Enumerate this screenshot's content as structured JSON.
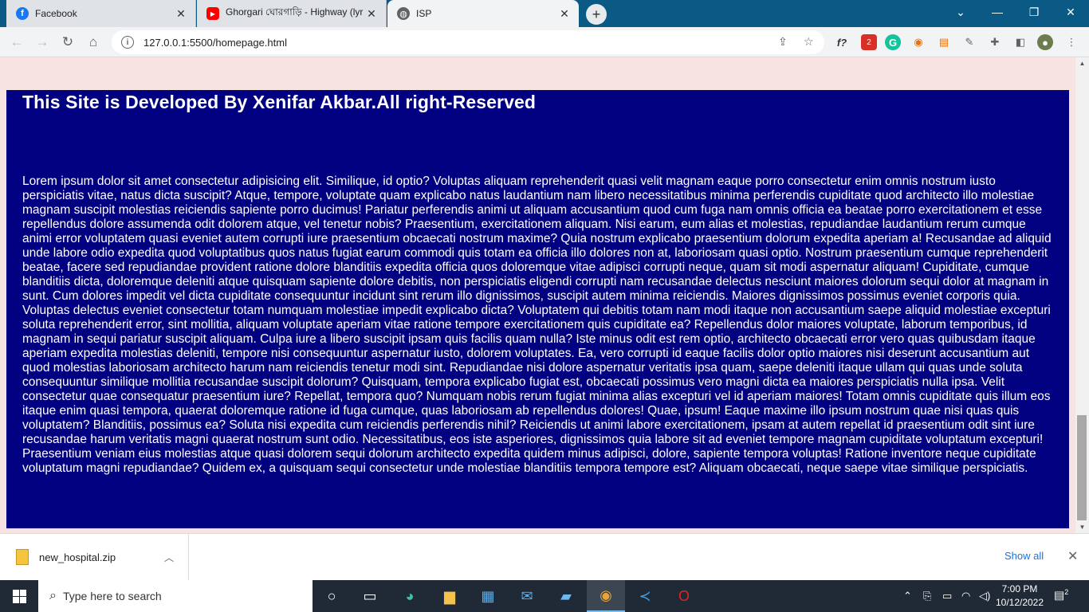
{
  "browser": {
    "tabs": [
      {
        "title": "Facebook",
        "icon": "facebook-icon",
        "active": false
      },
      {
        "title": "Ghorgari ঘোরগাড়ি - Highway (lyr",
        "icon": "youtube-icon",
        "active": false
      },
      {
        "title": "ISP",
        "icon": "globe-icon",
        "active": true
      }
    ],
    "new_tab_glyph": "+",
    "url": "127.0.0.1:5500/homepage.html"
  },
  "page": {
    "heading": "This Site is Developed By Xenifar Akbar.All right-Reserved",
    "body": "Lorem ipsum dolor sit amet consectetur adipisicing elit. Similique, id optio? Voluptas aliquam reprehenderit quasi velit magnam eaque porro consectetur enim omnis nostrum iusto perspiciatis vitae, natus dicta suscipit? Atque, tempore, voluptate quam explicabo natus laudantium nam libero necessitatibus minima perferendis cupiditate quod architecto illo molestiae magnam suscipit molestias reiciendis sapiente porro ducimus! Pariatur perferendis animi ut aliquam accusantium quod cum fuga nam omnis officia ea beatae porro exercitationem et esse repellendus dolore assumenda odit dolorem atque, vel tenetur nobis? Praesentium, exercitationem aliquam. Nisi earum, eum alias et molestias, repudiandae laudantium rerum cumque animi error voluptatem quasi eveniet autem corrupti iure praesentium obcaecati nostrum maxime? Quia nostrum explicabo praesentium dolorum expedita aperiam a! Recusandae ad aliquid unde labore odio expedita quod voluptatibus quos natus fugiat earum commodi quis totam ea officia illo dolores non at, laboriosam quasi optio. Nostrum praesentium cumque reprehenderit beatae, facere sed repudiandae provident ratione dolore blanditiis expedita officia quos doloremque vitae adipisci corrupti neque, quam sit modi aspernatur aliquam! Cupiditate, cumque blanditiis dicta, doloremque deleniti atque quisquam sapiente dolore debitis, non perspiciatis eligendi corrupti nam recusandae delectus nesciunt maiores dolorum sequi dolor at magnam in sunt. Cum dolores impedit vel dicta cupiditate consequuntur incidunt sint rerum illo dignissimos, suscipit autem minima reiciendis. Maiores dignissimos possimus eveniet corporis quia. Voluptas delectus eveniet consectetur totam numquam molestiae impedit explicabo dicta? Voluptatem qui debitis totam nam modi itaque non accusantium saepe aliquid molestiae excepturi soluta reprehenderit error, sint mollitia, aliquam voluptate aperiam vitae ratione tempore exercitationem quis cupiditate ea? Repellendus dolor maiores voluptate, laborum temporibus, id magnam in sequi pariatur suscipit aliquam. Culpa iure a libero suscipit ipsam quis facilis quam nulla? Iste minus odit est rem optio, architecto obcaecati error vero quas quibusdam itaque aperiam expedita molestias deleniti, tempore nisi consequuntur aspernatur iusto, dolorem voluptates. Ea, vero corrupti id eaque facilis dolor optio maiores nisi deserunt accusantium aut quod molestias laboriosam architecto harum nam reiciendis tenetur modi sint. Repudiandae nisi dolore aspernatur veritatis ipsa quam, saepe deleniti itaque ullam qui quas unde soluta consequuntur similique mollitia recusandae suscipit dolorum? Quisquam, tempora explicabo fugiat est, obcaecati possimus vero magni dicta ea maiores perspiciatis nulla ipsa. Velit consectetur quae consequatur praesentium iure? Repellat, tempora quo? Numquam nobis rerum fugiat minima alias excepturi vel id aperiam maiores! Totam omnis cupiditate quis illum eos itaque enim quasi tempora, quaerat doloremque ratione id fuga cumque, quas laboriosam ab repellendus dolores! Quae, ipsum! Eaque maxime illo ipsum nostrum quae nisi quas quis voluptatem? Blanditiis, possimus ea? Soluta nisi expedita cum reiciendis perferendis nihil? Reiciendis ut animi labore exercitationem, ipsam at autem repellat id praesentium odit sint iure recusandae harum veritatis magni quaerat nostrum sunt odio. Necessitatibus, eos iste asperiores, dignissimos quia labore sit ad eveniet tempore magnam cupiditate voluptatum excepturi! Praesentium veniam eius molestias atque quasi dolorem sequi dolorum architecto expedita quidem minus adipisci, dolore, sapiente tempora voluptas! Ratione inventore neque cupiditate voluptatum magni repudiandae? Quidem ex, a quisquam sequi consectetur unde molestiae blanditiis tempora tempore est? Aliquam obcaecati, neque saepe vitae similique perspiciatis.",
    "footer_bg": "#000080",
    "page_bg": "#f8e3e3"
  },
  "downloads": {
    "file_name": "new_hospital.zip",
    "show_all": "Show all"
  },
  "taskbar": {
    "search_placeholder": "Type here to search",
    "time": "7:00 PM",
    "date": "10/12/2022",
    "notification_count": "2"
  }
}
